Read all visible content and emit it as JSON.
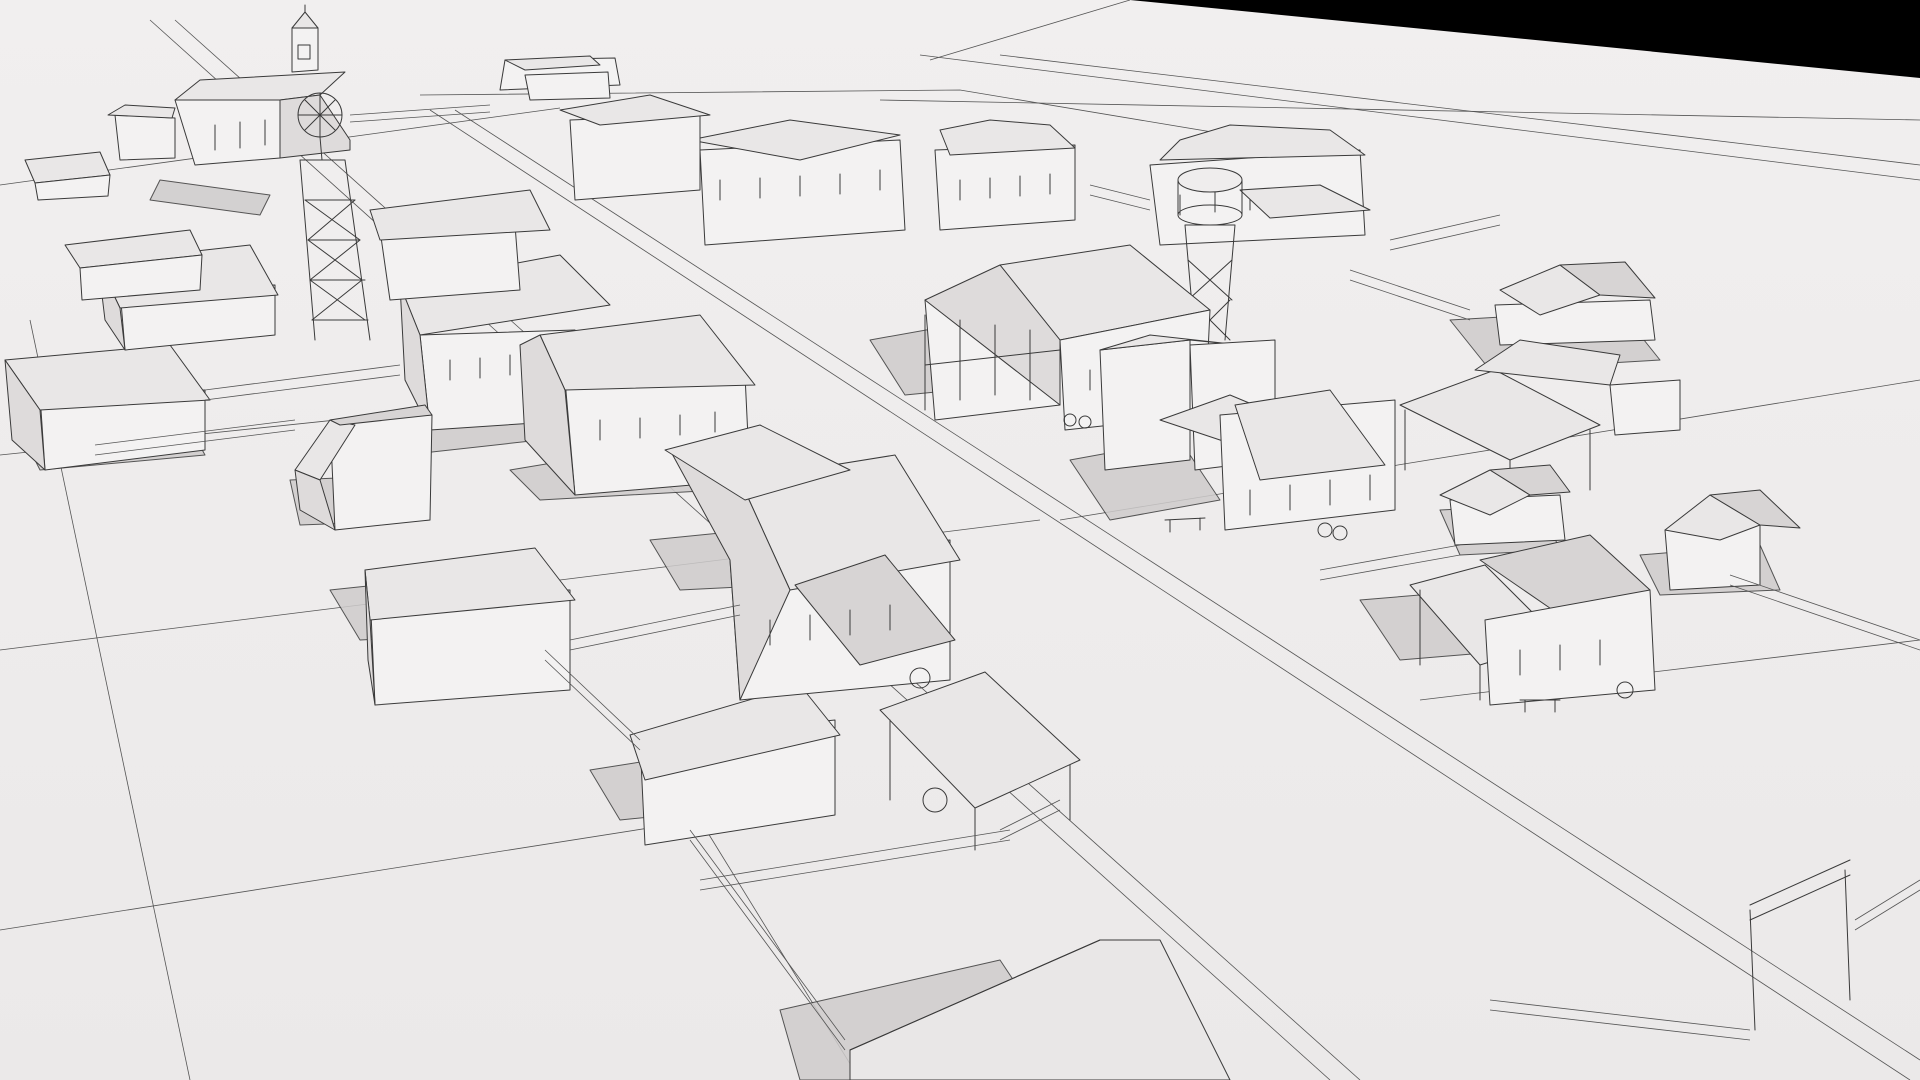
{
  "scene": {
    "kind": "3d-render-clay-wireframe",
    "subject": "western-frontier-town",
    "colors": {
      "ground": "#efeded",
      "sky": "#000000",
      "line": "#3a3a3a",
      "wall": "#f3f2f2",
      "roof": "#e4e1e1",
      "shadow": "#cfcccc"
    }
  }
}
